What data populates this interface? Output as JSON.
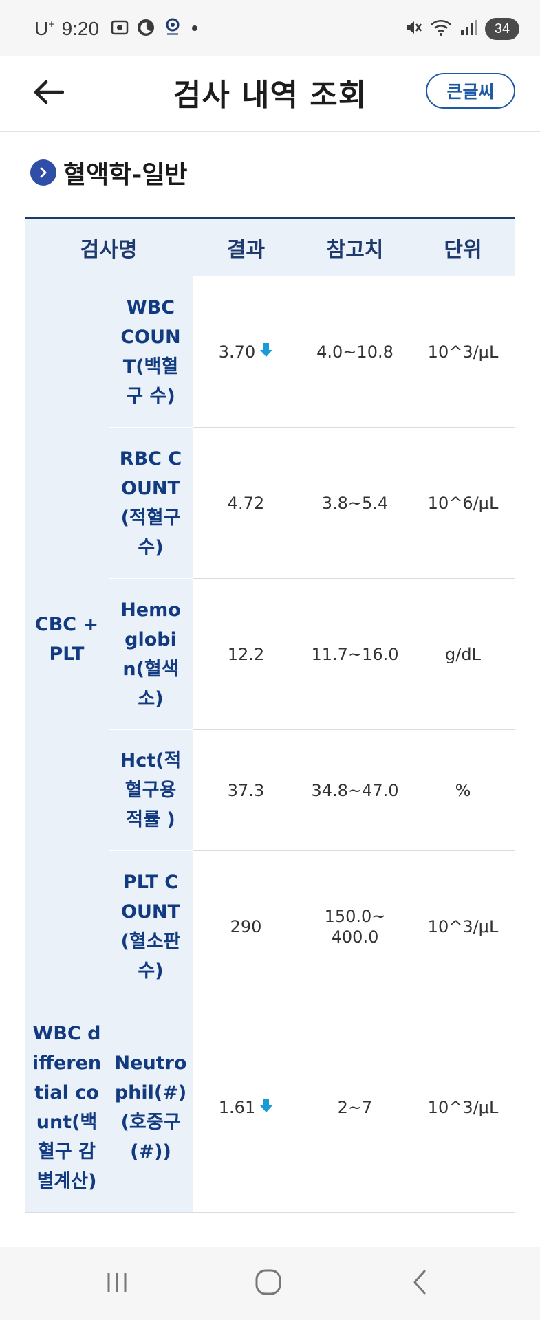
{
  "status_bar": {
    "carrier": "U",
    "carrier_sup": "+",
    "time": "9:20",
    "battery": "34"
  },
  "header": {
    "title": "검사 내역 조회",
    "big_font_label": "큰글씨"
  },
  "section": {
    "title": "혈액학-일반"
  },
  "table": {
    "columns": [
      "검사명",
      "결과",
      "참고치",
      "단위"
    ],
    "groups": [
      {
        "name": "CBC +PLT",
        "rows": [
          {
            "name": "WBC COUNT(백혈구 수)",
            "result": "3.70",
            "reference": "4.0~10.8",
            "unit": "10^3/μL"
          },
          {
            "name": "RBC COUNT(적혈구 수)",
            "result": "4.72",
            "reference": "3.8~5.4",
            "unit": "10^6/μL"
          },
          {
            "name": "Hemoglobin(혈색소)",
            "result": "12.2",
            "reference": "11.7~16.0",
            "unit": "g/dL"
          },
          {
            "name": "Hct(적혈구용적률 )",
            "result": "37.3",
            "reference": "34.8~47.0",
            "unit": "%"
          },
          {
            "name": "PLT COUNT(혈소판 수)",
            "result": "290",
            "reference": "150.0~ 400.0",
            "unit": "10^3/μL"
          }
        ]
      },
      {
        "name": "WBC differential count(백혈구 감별계산)",
        "rows": [
          {
            "name": "Neutrophil(#)(호중구(#))",
            "result": "1.61",
            "reference": "2~7",
            "unit": "10^3/μL"
          }
        ]
      }
    ]
  },
  "colors": {
    "accent": "#1f5aa6",
    "header_bg": "#eaf1f8",
    "low_arrow": "#1a9bd7",
    "name_text": "#123a80"
  },
  "icons": {
    "back": "arrow-left-icon",
    "section": "chevron-right-icon",
    "low_indicator": "arrow-down-icon"
  }
}
